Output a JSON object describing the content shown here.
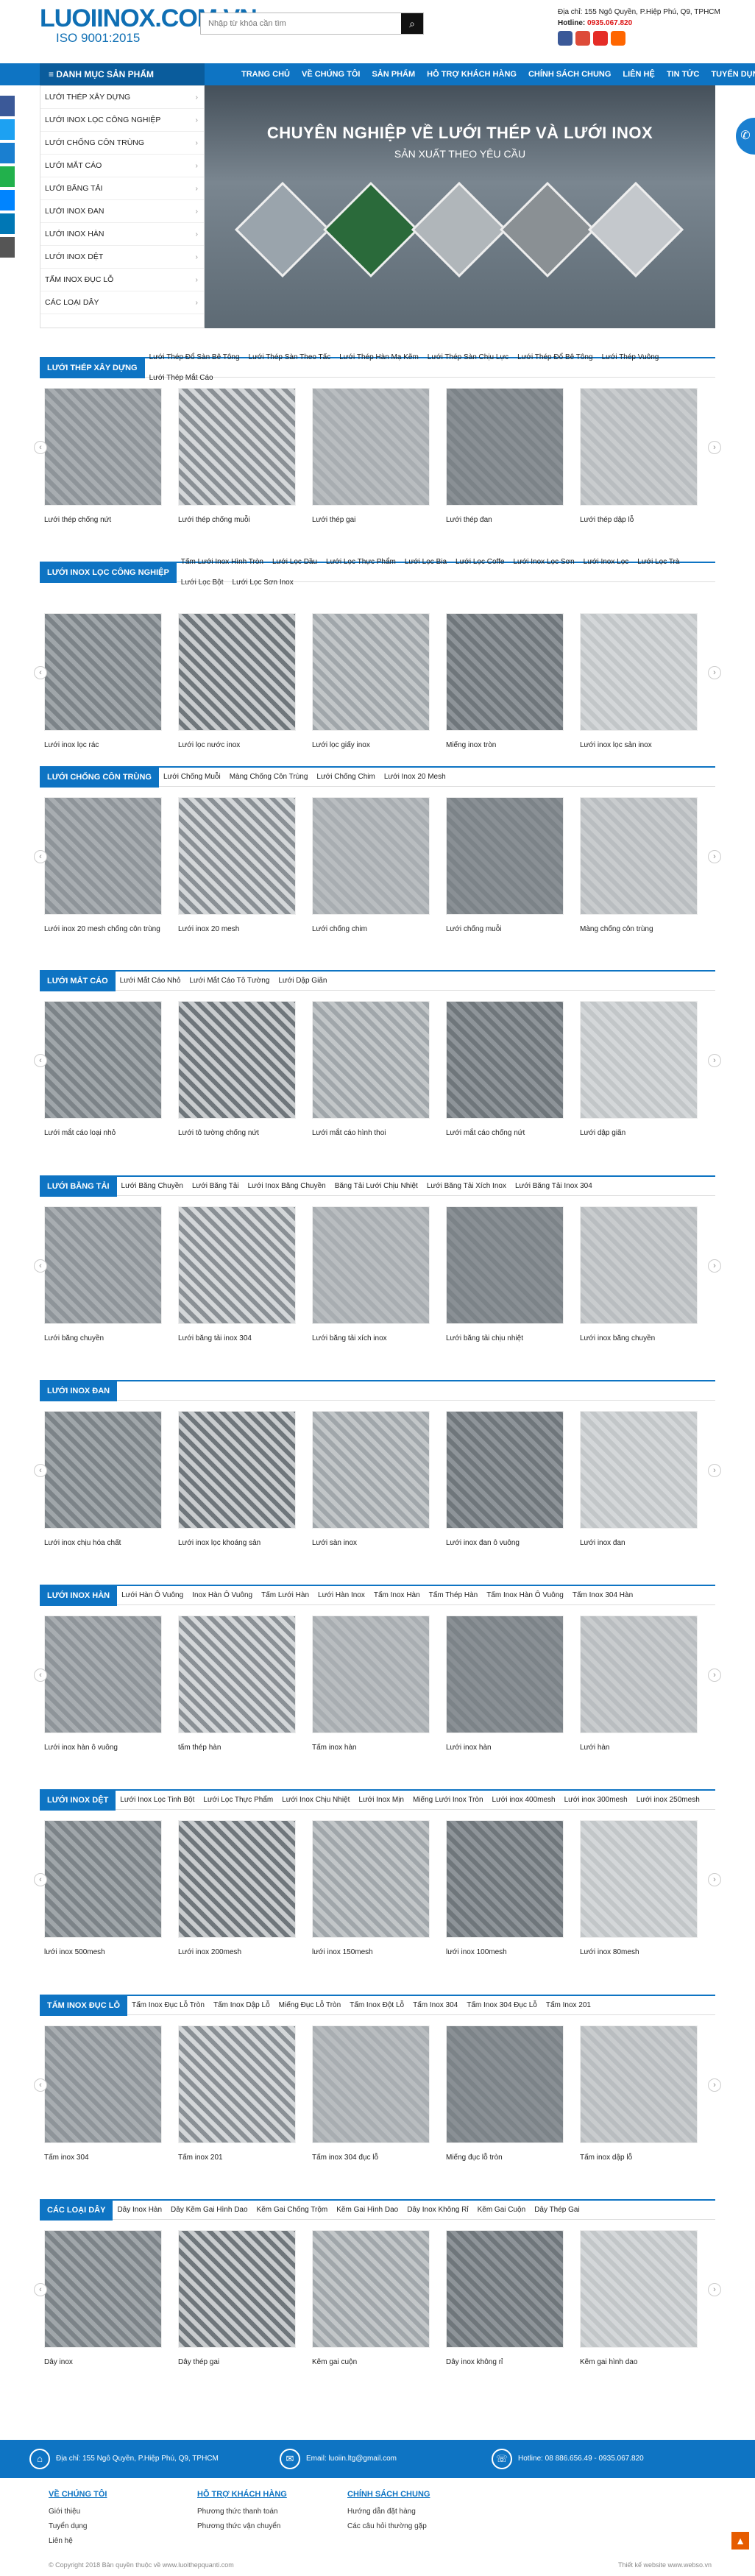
{
  "header": {
    "logo_main": "LUOIINOX.COM.VN",
    "logo_sub": "ISO 9001:2015",
    "search_placeholder": "Nhập từ khóa cần tìm",
    "address": "Địa chỉ: 155 Ngô Quyền, P.Hiệp Phú, Q9, TPHCM",
    "hotline_label": "Hotline:",
    "hotline": "0935.067.820"
  },
  "nav": {
    "category_label": "DANH MỤC SẢN PHẨM",
    "items": [
      "TRANG CHỦ",
      "VỀ CHÚNG TÔI",
      "SẢN PHẨM",
      "HỖ TRỢ KHÁCH HÀNG",
      "CHÍNH SÁCH CHUNG",
      "LIÊN HỆ",
      "TIN TỨC",
      "TUYỂN DỤNG"
    ]
  },
  "side_menu": [
    "LƯỚI THÉP XÂY DỰNG",
    "LƯỚI INOX LỌC CÔNG NGHIỆP",
    "LƯỚI CHỐNG CÔN TRÙNG",
    "LƯỚI MẮT CÁO",
    "LƯỚI BĂNG TẢI",
    "LƯỚI INOX ĐAN",
    "LƯỚI INOX HÀN",
    "LƯỚI INOX DỆT",
    "TẤM INOX ĐỤC LỖ",
    "CÁC LOẠI DÂY"
  ],
  "hero": {
    "title": "CHUYÊN NGHIỆP VỀ LƯỚI THÉP VÀ LƯỚI INOX",
    "subtitle": "SẢN XUẤT THEO YÊU CẦU"
  },
  "sections": [
    {
      "title": "LƯỚI THÉP XÂY DỰNG",
      "tabs": [
        "Lưới Thép Đổ Sàn Bê Tông",
        "Lưới Thép Sàn Theo Tấc",
        "Lưới Thép Hàn Mạ Kẽm",
        "Lưới Thép Sàn Chịu Lực",
        "Lưới Thép Đổ Bê Tông",
        "Lưới Thép Vuông",
        "Lưới Thép Mắt Cáo"
      ],
      "products": [
        "Lưới thép chống nứt",
        "Lưới thép chống muỗi",
        "Lưới thép gai",
        "Lưới thép đan",
        "Lưới thép dập lỗ"
      ]
    },
    {
      "title": "LƯỚI INOX LỌC CÔNG NGHIỆP",
      "tabs": [
        "Tấm Lưới Inox Hình Tròn",
        "Lưới Lọc Dầu",
        "Lưới Lọc Thực Phẩm",
        "Lưới Lọc Bia",
        "Lưới Lọc Coffe",
        "Lưới Inox Lọc Sơn",
        "Lưới Inox Lọc",
        "Lưới Lọc Trà",
        "Lưới Lọc Bột",
        "Lưới Lọc Sơn Inox"
      ],
      "products": [
        "Lưới inox lọc rác",
        "Lưới lọc nước inox",
        "Lưới lọc giấy inox",
        "Miếng inox tròn",
        "Lưới inox lọc sản inox"
      ]
    },
    {
      "title": "LƯỚI CHỐNG CÔN TRÙNG",
      "tabs": [
        "Lưới Chống Muỗi",
        "Màng Chống Côn Trùng",
        "Lưới Chống Chim",
        "Lưới Inox 20 Mesh"
      ],
      "products": [
        "Lưới inox 20 mesh chống côn trùng",
        "Lưới inox 20 mesh",
        "Lưới chống chim",
        "Lưới chống muỗi",
        "Màng chống côn trùng"
      ]
    },
    {
      "title": "LƯỚI MẮT CÁO",
      "tabs": [
        "Lưới Mắt Cáo Nhỏ",
        "Lưới Mắt Cáo Tô Tường",
        "Lưới Dập Giãn"
      ],
      "products": [
        "Lưới mắt cáo loại nhỏ",
        "Lưới tô tường chống nứt",
        "Lưới mắt cáo hình thoi",
        "Lưới mắt cáo chống nứt",
        "Lưới dập giãn"
      ]
    },
    {
      "title": "LƯỚI BĂNG TẢI",
      "tabs": [
        "Lưới Băng Chuyền",
        "Lưới Băng Tải",
        "Lưới Inox Băng Chuyền",
        "Băng Tải Lưới Chịu Nhiệt",
        "Lưới Băng Tải Xích Inox",
        "Lưới Băng Tải Inox 304"
      ],
      "products": [
        "Lưới băng chuyền",
        "Lưới băng tải inox 304",
        "Lưới băng tải xích inox",
        "Lưới băng tải chịu nhiệt",
        "Lưới inox băng chuyền"
      ]
    },
    {
      "title": "LƯỚI INOX ĐAN",
      "tabs": [],
      "products": [
        "Lưới inox chịu hóa chất",
        "Lưới inox lọc khoáng sản",
        "Lưới sàn inox",
        "Lưới inox đan ô vuông",
        "Lưới inox đan"
      ]
    },
    {
      "title": "LƯỚI INOX HÀN",
      "tabs": [
        "Lưới Hàn Ô Vuông",
        "Inox Hàn Ô Vuông",
        "Tấm Lưới Hàn",
        "Lưới Hàn Inox",
        "Tấm Inox Hàn",
        "Tấm Thép Hàn",
        "Tấm Inox Hàn Ô Vuông",
        "Tấm Inox 304 Hàn"
      ],
      "products": [
        "Lưới inox hàn ô vuông",
        "tấm thép hàn",
        "Tấm inox hàn",
        "Lưới inox hàn",
        "Lưới hàn"
      ]
    },
    {
      "title": "LƯỚI INOX DỆT",
      "tabs": [
        "Lưới Inox Lọc Tinh Bột",
        "Lưới Lọc Thực Phẩm",
        "Lưới Inox Chịu Nhiệt",
        "Lưới Inox Mịn",
        "Miếng Lưới Inox Tròn",
        "Lưới inox 400mesh",
        "Lưới inox 300mesh",
        "Lưới inox 250mesh"
      ],
      "products": [
        "lưới inox 500mesh",
        "Lưới inox 200mesh",
        "lưới inox 150mesh",
        "lưới inox 100mesh",
        "Lưới inox 80mesh"
      ]
    },
    {
      "title": "TẤM INOX ĐỤC LỖ",
      "tabs": [
        "Tấm Inox Đục Lỗ Tròn",
        "Tấm Inox Dập Lỗ",
        "Miếng Đục Lỗ Tròn",
        "Tấm Inox Đột Lỗ",
        "Tấm Inox 304",
        "Tấm Inox 304 Đục Lỗ",
        "Tấm Inox 201"
      ],
      "products": [
        "Tấm inox 304",
        "Tấm inox 201",
        "Tấm inox 304 đục lỗ",
        "Miếng đục lỗ tròn",
        "Tấm inox dập lỗ"
      ]
    },
    {
      "title": "CÁC LOẠI DÂY",
      "tabs": [
        "Dây Inox Hàn",
        "Dây Kẽm Gai Hình Dao",
        "Kẽm Gai Chống Trộm",
        "Kẽm Gai Hình Dao",
        "Dây Inox Không Rỉ",
        "Kẽm Gai Cuộn",
        "Dây Thép Gai"
      ],
      "products": [
        "Dây inox",
        "Dây thép gai",
        "Kẽm gai cuộn",
        "Dây inox không rỉ",
        "Kẽm gai hình dao"
      ]
    }
  ],
  "footer": {
    "address": "Địa chỉ: 155 Ngô Quyền, P.Hiệp Phú, Q9, TPHCM",
    "email": "Email: luoiin.ltg@gmail.com",
    "hotline": "Hotline: 08 886.656.49 - 0935.067.820",
    "col1_title": "VỀ CHÚNG TÔI",
    "col1": [
      "Giới thiệu",
      "Tuyển dụng",
      "Liên hệ"
    ],
    "col2_title": "HỖ TRỢ KHÁCH HÀNG",
    "col2": [
      "Phương thức thanh toán",
      "Phương thức vận chuyển"
    ],
    "col3_title": "CHÍNH SÁCH CHUNG",
    "col3": [
      "Hướng dẫn đặt hàng",
      "Các câu hỏi thường gặp"
    ],
    "copyright": "© Copyright 2018 Bản quyền thuộc về www.luoithepquanti.com",
    "designer": "Thiết kế website www.webso.vn"
  }
}
